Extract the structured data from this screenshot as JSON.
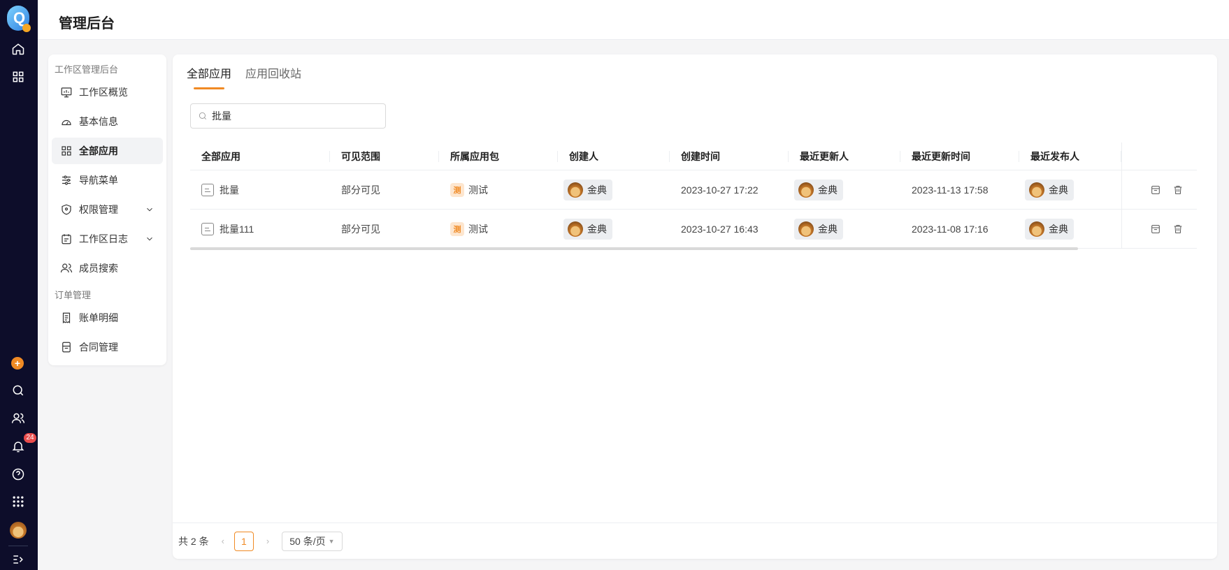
{
  "app": {
    "title": "管理后台",
    "logo_letter": "Q"
  },
  "rail": {
    "notification_count": "24"
  },
  "sidebar": {
    "groups": [
      {
        "label": "工作区管理后台"
      },
      {
        "label": "订单管理"
      }
    ],
    "items": [
      {
        "label": "工作区概览",
        "icon": "monitor-icon"
      },
      {
        "label": "基本信息",
        "icon": "dashboard-icon"
      },
      {
        "label": "全部应用",
        "icon": "grid-icon",
        "active": true
      },
      {
        "label": "导航菜单",
        "icon": "sliders-icon"
      },
      {
        "label": "权限管理",
        "icon": "shield-icon",
        "expandable": true
      },
      {
        "label": "工作区日志",
        "icon": "calendar-icon",
        "expandable": true
      },
      {
        "label": "成员搜索",
        "icon": "users-icon"
      },
      {
        "label": "账单明细",
        "icon": "receipt-icon"
      },
      {
        "label": "合同管理",
        "icon": "contract-icon"
      }
    ]
  },
  "main": {
    "tabs": [
      {
        "label": "全部应用",
        "active": true
      },
      {
        "label": "应用回收站",
        "active": false
      }
    ],
    "search": {
      "value": "批量",
      "placeholder": ""
    },
    "table": {
      "columns": [
        "全部应用",
        "可见范围",
        "所属应用包",
        "创建人",
        "创建时间",
        "最近更新人",
        "最近更新时间",
        "最近发布人",
        ""
      ],
      "rows": [
        {
          "name": "批量",
          "scope": "部分可见",
          "package_icon": "测",
          "package": "测试",
          "creator": "金典",
          "created": "2023-10-27 17:22",
          "updater": "金典",
          "updated": "2023-11-13 17:58",
          "publisher": "金典"
        },
        {
          "name": "批量111",
          "scope": "部分可见",
          "package_icon": "测",
          "package": "测试",
          "creator": "金典",
          "created": "2023-10-27 16:43",
          "updater": "金典",
          "updated": "2023-11-08 17:16",
          "publisher": "金典"
        }
      ]
    },
    "pagination": {
      "total": "共 2 条",
      "current_page": "1",
      "page_size": "50 条/页"
    }
  },
  "colors": {
    "accent": "#f08a24",
    "rail_bg": "#0d0d2a",
    "badge": "#e94c4c"
  }
}
